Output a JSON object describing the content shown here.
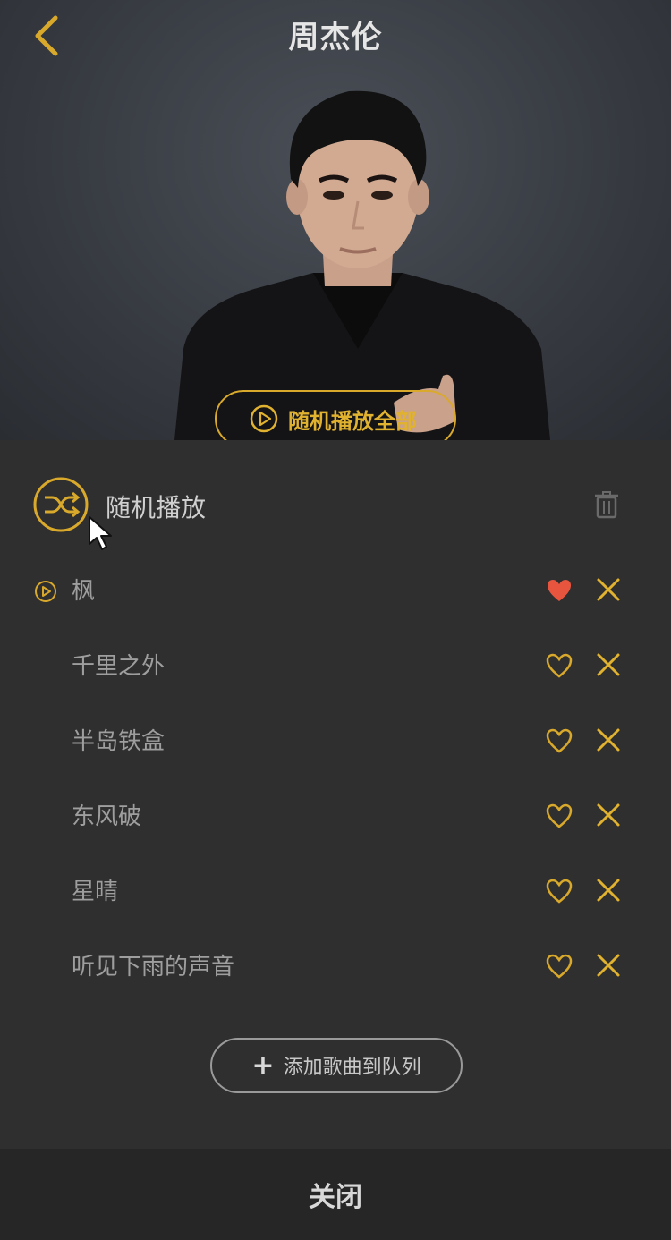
{
  "header": {
    "title": "周杰伦",
    "shuffle_all_label": "随机播放全部"
  },
  "queue": {
    "shuffle_label": "随机播放",
    "songs": [
      {
        "title": "枫",
        "playing": true,
        "liked": true
      },
      {
        "title": "千里之外",
        "playing": false,
        "liked": false
      },
      {
        "title": "半岛铁盒",
        "playing": false,
        "liked": false
      },
      {
        "title": "东风破",
        "playing": false,
        "liked": false
      },
      {
        "title": "星晴",
        "playing": false,
        "liked": false
      },
      {
        "title": "听见下雨的声音",
        "playing": false,
        "liked": false
      }
    ],
    "add_label": "添加歌曲到队列",
    "add_icon": "+"
  },
  "footer": {
    "close_label": "关闭"
  },
  "colors": {
    "accent": "#d9a92b",
    "liked": "#e8553f",
    "panel": "#2f2f2f"
  }
}
